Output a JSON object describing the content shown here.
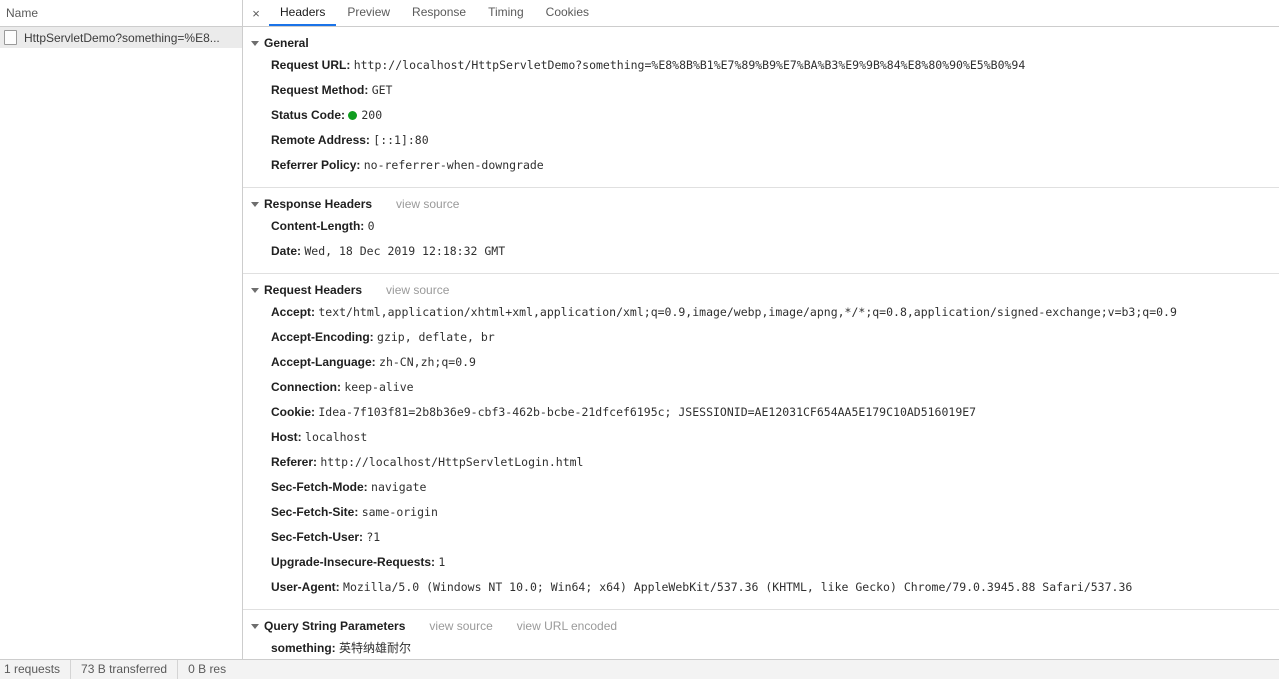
{
  "requests_panel": {
    "column_header": "Name",
    "rows": [
      {
        "name": "HttpServletDemo?something=%E8...",
        "icon": "document-icon"
      }
    ]
  },
  "tabbar": {
    "close_label": "×",
    "tabs": [
      {
        "label": "Headers",
        "active": true
      },
      {
        "label": "Preview",
        "active": false
      },
      {
        "label": "Response",
        "active": false
      },
      {
        "label": "Timing",
        "active": false
      },
      {
        "label": "Cookies",
        "active": false
      }
    ]
  },
  "sections": {
    "general": {
      "title": "General",
      "rows": [
        {
          "key": "Request URL:",
          "value": "http://localhost/HttpServletDemo?something=%E8%8B%B1%E7%89%B9%E7%BA%B3%E9%9B%84%E8%80%90%E5%B0%94"
        },
        {
          "key": "Request Method:",
          "value": "GET"
        },
        {
          "key": "Status Code:",
          "value": "200",
          "status_dot": true,
          "status_color": "#0f9d1f"
        },
        {
          "key": "Remote Address:",
          "value": "[::1]:80"
        },
        {
          "key": "Referrer Policy:",
          "value": "no-referrer-when-downgrade"
        }
      ]
    },
    "response_headers": {
      "title": "Response Headers",
      "view_source": "view source",
      "rows": [
        {
          "key": "Content-Length:",
          "value": "0"
        },
        {
          "key": "Date:",
          "value": "Wed, 18 Dec 2019 12:18:32 GMT"
        }
      ]
    },
    "request_headers": {
      "title": "Request Headers",
      "view_source": "view source",
      "rows": [
        {
          "key": "Accept:",
          "value": "text/html,application/xhtml+xml,application/xml;q=0.9,image/webp,image/apng,*/*;q=0.8,application/signed-exchange;v=b3;q=0.9"
        },
        {
          "key": "Accept-Encoding:",
          "value": "gzip, deflate, br"
        },
        {
          "key": "Accept-Language:",
          "value": "zh-CN,zh;q=0.9"
        },
        {
          "key": "Connection:",
          "value": "keep-alive"
        },
        {
          "key": "Cookie:",
          "value": "Idea-7f103f81=2b8b36e9-cbf3-462b-bcbe-21dfcef6195c; JSESSIONID=AE12031CF654AA5E179C10AD516019E7"
        },
        {
          "key": "Host:",
          "value": "localhost"
        },
        {
          "key": "Referer:",
          "value": "http://localhost/HttpServletLogin.html"
        },
        {
          "key": "Sec-Fetch-Mode:",
          "value": "navigate"
        },
        {
          "key": "Sec-Fetch-Site:",
          "value": "same-origin"
        },
        {
          "key": "Sec-Fetch-User:",
          "value": "?1"
        },
        {
          "key": "Upgrade-Insecure-Requests:",
          "value": "1"
        },
        {
          "key": "User-Agent:",
          "value": "Mozilla/5.0 (Windows NT 10.0; Win64; x64) AppleWebKit/537.36 (KHTML, like Gecko) Chrome/79.0.3945.88 Safari/537.36"
        }
      ]
    },
    "query_string_parameters": {
      "title": "Query String Parameters",
      "view_source": "view source",
      "view_url_encoded": "view URL encoded",
      "rows": [
        {
          "key": "something:",
          "value": "英特纳雄耐尔"
        }
      ]
    }
  },
  "statusbar": {
    "requests": "1 requests",
    "transferred": "73 B transferred",
    "resources": "0 B res"
  }
}
